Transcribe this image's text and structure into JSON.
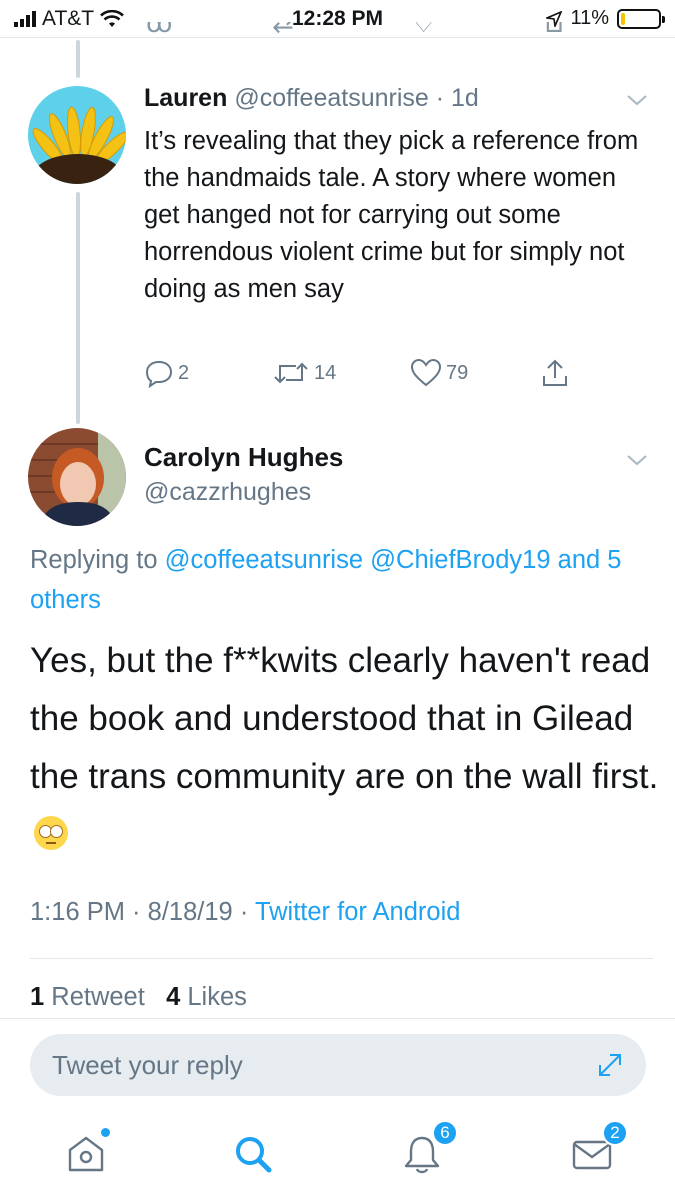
{
  "status_bar": {
    "carrier": "AT&T",
    "time": "12:28 PM",
    "battery": "11%",
    "battery_level": 0.11
  },
  "tweet_lauren": {
    "name": "Lauren",
    "handle": "@coffeeatsunrise",
    "age": "1d",
    "text": "It’s revealing that they pick a reference from the handmaids tale. A story where women get hanged not for carrying out some horrendous violent crime but for simply not doing as men say",
    "replies": "2",
    "retweets": "14",
    "likes": "79"
  },
  "tweet_carolyn": {
    "name": "Carolyn Hughes",
    "handle": "@cazzrhughes",
    "replying_prefix": "Replying to",
    "replying_handle_1": "@coffeeatsunrise",
    "replying_handle_2": "@ChiefBrody19",
    "replying_others": "and 5 others",
    "text": "Yes, but the f**kwits clearly haven't read the book and understood that in Gilead the trans community are on the wall first.",
    "time": "1:16 PM",
    "date": "8/18/19",
    "source": "Twitter for Android",
    "retweet_count": "1",
    "retweet_label": "Retweet",
    "like_count": "4",
    "like_label": "Likes"
  },
  "reply_box": {
    "placeholder": "Tweet your reply"
  },
  "tab_bar": {
    "notifications_badge": "6",
    "messages_badge": "2"
  },
  "colors": {
    "accent": "#1da1f2",
    "secondary_text": "#657786",
    "thread_line": "#ccd6dd"
  }
}
